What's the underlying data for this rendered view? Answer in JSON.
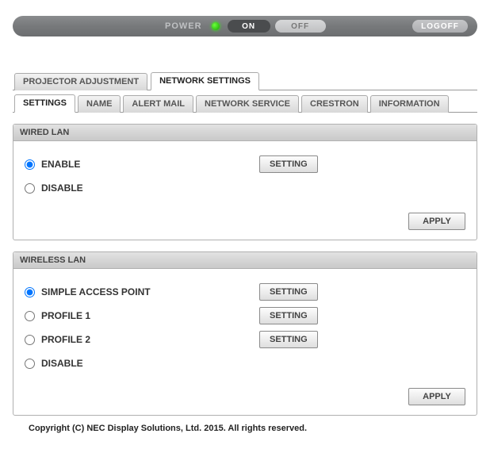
{
  "power_bar": {
    "label": "POWER",
    "on": "ON",
    "off": "OFF",
    "logoff": "LOGOFF"
  },
  "main_tabs": {
    "projector_adjustment": "PROJECTOR ADJUSTMENT",
    "network_settings": "NETWORK SETTINGS",
    "active": "network_settings"
  },
  "sub_tabs": {
    "settings": "SETTINGS",
    "name": "NAME",
    "alert_mail": "ALERT MAIL",
    "network_service": "NETWORK SERVICE",
    "crestron": "CRESTRON",
    "information": "INFORMATION",
    "active": "settings"
  },
  "wired_lan": {
    "title": "WIRED LAN",
    "options": {
      "enable": "ENABLE",
      "disable": "DISABLE"
    },
    "selected": "enable",
    "setting_btn": "SETTING",
    "apply_btn": "APPLY"
  },
  "wireless_lan": {
    "title": "WIRELESS LAN",
    "options": {
      "simple_ap": "SIMPLE ACCESS POINT",
      "profile1": "PROFILE 1",
      "profile2": "PROFILE 2",
      "disable": "DISABLE"
    },
    "selected": "simple_ap",
    "setting_btn": "SETTING",
    "apply_btn": "APPLY"
  },
  "copyright": "Copyright (C) NEC Display Solutions, Ltd. 2015. All rights reserved."
}
